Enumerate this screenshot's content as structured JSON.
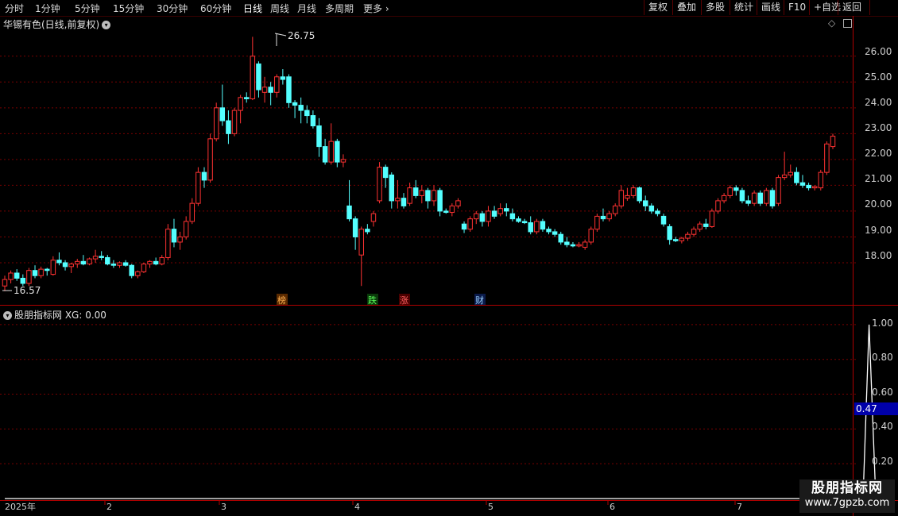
{
  "toolbar": {
    "tabs": [
      "分时",
      "1分钟",
      "5分钟",
      "15分钟",
      "30分钟",
      "60分钟",
      "日线",
      "周线",
      "月线",
      "多周期",
      "更多"
    ],
    "right_buttons": [
      "复权",
      "叠加",
      "多股",
      "统计",
      "画线",
      "F10",
      "+自选",
      "返回"
    ]
  },
  "main_panel": {
    "title": "华锡有色(日线,前复权)",
    "price_axis_labels": [
      "26.00",
      "25.00",
      "24.00",
      "23.00",
      "22.00",
      "21.00",
      "20.00",
      "19.00",
      "18.00"
    ],
    "high_label": "26.75",
    "low_label": "16.57",
    "event_markers": [
      "榜",
      "跌",
      "涨",
      "财"
    ]
  },
  "indicator_panel": {
    "title": "股朋指标网 XG: 0.00",
    "axis_labels": [
      "1.00",
      "0.80",
      "0.60",
      "0.40",
      "0.20"
    ],
    "current_value": "0.47"
  },
  "time_axis": {
    "labels": [
      "2025年",
      "2",
      "3",
      "4",
      "5",
      "6",
      "7"
    ]
  },
  "watermark": {
    "line1": "股朋指标网",
    "line2": "www.7gpzb.com"
  },
  "colors": {
    "up": "#ff3232",
    "down": "#54ffff",
    "grid": "#7a0000",
    "axis": "#b00000"
  },
  "chart_data": [
    {
      "type": "candlestick",
      "title": "华锡有色(日线,前复权)",
      "ylim": [
        16.4,
        27.1
      ],
      "annotations": {
        "high": 26.75,
        "low": 16.57
      },
      "candles": [
        [
          17.1,
          17.5,
          16.9,
          17.35
        ],
        [
          17.35,
          17.7,
          17.2,
          17.6
        ],
        [
          17.6,
          17.75,
          17.3,
          17.4
        ],
        [
          17.4,
          17.55,
          17.1,
          17.2
        ],
        [
          17.2,
          17.8,
          17.1,
          17.7
        ],
        [
          17.7,
          17.9,
          17.4,
          17.5
        ],
        [
          17.5,
          17.85,
          17.4,
          17.75
        ],
        [
          17.75,
          17.8,
          17.5,
          17.7
        ],
        [
          17.55,
          18.25,
          17.5,
          18.1
        ],
        [
          18.1,
          18.4,
          17.9,
          18.0
        ],
        [
          18.0,
          18.1,
          17.7,
          17.85
        ],
        [
          17.85,
          18.0,
          17.6,
          17.95
        ],
        [
          17.95,
          18.15,
          17.8,
          18.05
        ],
        [
          18.05,
          18.3,
          17.9,
          17.95
        ],
        [
          17.95,
          18.2,
          17.9,
          18.15
        ],
        [
          18.15,
          18.5,
          18.0,
          18.25
        ],
        [
          18.25,
          18.45,
          18.1,
          18.2
        ],
        [
          18.2,
          18.3,
          17.9,
          17.95
        ],
        [
          17.95,
          18.1,
          17.8,
          17.9
        ],
        [
          17.9,
          18.05,
          17.8,
          18.0
        ],
        [
          18.0,
          18.1,
          17.85,
          17.9
        ],
        [
          17.9,
          17.95,
          17.4,
          17.5
        ],
        [
          17.5,
          17.7,
          17.4,
          17.65
        ],
        [
          17.65,
          18.0,
          17.6,
          17.95
        ],
        [
          17.95,
          18.1,
          17.8,
          18.05
        ],
        [
          18.05,
          18.2,
          17.9,
          17.95
        ],
        [
          17.95,
          18.3,
          17.9,
          18.2
        ],
        [
          18.2,
          19.5,
          18.1,
          19.3
        ],
        [
          19.3,
          19.7,
          18.6,
          18.8
        ],
        [
          18.8,
          19.2,
          18.5,
          19.0
        ],
        [
          19.0,
          19.8,
          18.9,
          19.6
        ],
        [
          19.6,
          20.5,
          19.5,
          20.3
        ],
        [
          20.3,
          21.7,
          20.2,
          21.5
        ],
        [
          21.5,
          21.7,
          20.9,
          21.2
        ],
        [
          21.2,
          23.0,
          21.1,
          22.8
        ],
        [
          22.8,
          24.2,
          22.7,
          24.0
        ],
        [
          24.0,
          24.9,
          23.3,
          23.5
        ],
        [
          23.5,
          23.9,
          22.6,
          23.0
        ],
        [
          23.0,
          24.0,
          22.9,
          23.9
        ],
        [
          23.9,
          24.5,
          23.4,
          24.4
        ],
        [
          24.4,
          24.6,
          24.2,
          24.35
        ],
        [
          24.35,
          26.75,
          24.3,
          26.0
        ],
        [
          25.7,
          25.8,
          24.4,
          24.7
        ],
        [
          24.6,
          25.2,
          24.2,
          24.8
        ],
        [
          24.8,
          25.0,
          24.1,
          24.6
        ],
        [
          24.6,
          25.3,
          24.4,
          25.2
        ],
        [
          25.2,
          25.5,
          24.9,
          25.1
        ],
        [
          25.2,
          25.3,
          24.0,
          24.2
        ],
        [
          24.2,
          24.3,
          23.6,
          24.1
        ],
        [
          24.1,
          24.4,
          23.4,
          23.9
        ],
        [
          23.9,
          24.1,
          23.4,
          23.7
        ],
        [
          23.7,
          23.9,
          23.2,
          23.3
        ],
        [
          23.3,
          23.6,
          22.1,
          22.5
        ],
        [
          22.5,
          22.8,
          21.8,
          21.9
        ],
        [
          21.9,
          23.4,
          21.8,
          22.7
        ],
        [
          22.7,
          22.8,
          21.7,
          21.9
        ],
        [
          21.9,
          22.2,
          21.7,
          22.0
        ],
        [
          20.2,
          21.2,
          19.6,
          19.7
        ],
        [
          19.7,
          19.8,
          18.5,
          19.0
        ],
        [
          18.3,
          19.4,
          17.1,
          19.3
        ],
        [
          19.3,
          19.5,
          19.1,
          19.2
        ],
        [
          19.6,
          20.0,
          19.4,
          19.9
        ],
        [
          20.4,
          21.9,
          20.3,
          21.7
        ],
        [
          21.7,
          21.8,
          20.9,
          21.3
        ],
        [
          21.4,
          21.5,
          20.1,
          20.4
        ],
        [
          20.4,
          21.2,
          20.1,
          20.5
        ],
        [
          20.5,
          20.7,
          20.1,
          20.2
        ],
        [
          20.3,
          21.1,
          20.2,
          20.9
        ],
        [
          20.9,
          21.2,
          20.5,
          20.6
        ],
        [
          20.6,
          21.0,
          20.3,
          20.8
        ],
        [
          20.8,
          20.9,
          20.1,
          20.4
        ],
        [
          20.4,
          21.0,
          20.2,
          20.8
        ],
        [
          20.8,
          20.9,
          19.8,
          20.0
        ],
        [
          20.0,
          20.1,
          19.9,
          19.95
        ],
        [
          19.95,
          20.3,
          19.8,
          20.2
        ],
        [
          20.2,
          20.5,
          20.1,
          20.4
        ],
        [
          19.5,
          19.6,
          19.15,
          19.3
        ],
        [
          19.3,
          19.8,
          19.2,
          19.7
        ],
        [
          19.7,
          20.0,
          19.5,
          19.9
        ],
        [
          19.9,
          20.0,
          19.4,
          19.6
        ],
        [
          19.6,
          20.2,
          19.4,
          20.0
        ],
        [
          20.0,
          20.2,
          19.7,
          19.8
        ],
        [
          19.9,
          20.3,
          19.8,
          20.1
        ],
        [
          20.1,
          20.3,
          19.8,
          20.0
        ],
        [
          19.9,
          20.1,
          19.6,
          19.7
        ],
        [
          19.7,
          19.8,
          19.55,
          19.6
        ],
        [
          19.6,
          19.7,
          19.5,
          19.55
        ],
        [
          19.55,
          19.8,
          19.1,
          19.2
        ],
        [
          19.2,
          19.7,
          19.1,
          19.6
        ],
        [
          19.6,
          19.7,
          19.2,
          19.3
        ],
        [
          19.3,
          19.4,
          19.1,
          19.2
        ],
        [
          19.2,
          19.3,
          19.0,
          19.1
        ],
        [
          19.1,
          19.2,
          18.7,
          18.8
        ],
        [
          18.8,
          19.0,
          18.6,
          18.7
        ],
        [
          18.7,
          18.8,
          18.6,
          18.65
        ],
        [
          18.65,
          18.8,
          18.6,
          18.7
        ],
        [
          18.6,
          18.9,
          18.5,
          18.8
        ],
        [
          18.8,
          19.4,
          18.7,
          19.3
        ],
        [
          19.3,
          19.9,
          19.2,
          19.8
        ],
        [
          19.8,
          20.1,
          19.6,
          19.7
        ],
        [
          19.7,
          20.0,
          19.6,
          19.9
        ],
        [
          19.9,
          20.3,
          19.8,
          20.2
        ],
        [
          20.2,
          21.0,
          20.1,
          20.8
        ],
        [
          20.5,
          20.9,
          20.4,
          20.6
        ],
        [
          20.6,
          21.0,
          20.5,
          20.9
        ],
        [
          20.9,
          20.95,
          20.3,
          20.4
        ],
        [
          20.4,
          20.6,
          20.0,
          20.2
        ],
        [
          20.2,
          20.3,
          19.9,
          20.0
        ],
        [
          20.0,
          20.1,
          19.8,
          19.9
        ],
        [
          19.8,
          19.9,
          19.4,
          19.5
        ],
        [
          19.4,
          19.5,
          18.7,
          18.9
        ],
        [
          18.9,
          19.0,
          18.8,
          18.85
        ],
        [
          18.85,
          19.0,
          18.75,
          18.95
        ],
        [
          18.95,
          19.2,
          18.85,
          19.1
        ],
        [
          19.1,
          19.4,
          19.0,
          19.3
        ],
        [
          19.3,
          19.6,
          19.2,
          19.5
        ],
        [
          19.5,
          19.7,
          19.3,
          19.4
        ],
        [
          19.4,
          20.1,
          19.35,
          20.0
        ],
        [
          20.0,
          20.5,
          19.9,
          20.4
        ],
        [
          20.4,
          20.7,
          20.3,
          20.6
        ],
        [
          20.6,
          21.0,
          20.5,
          20.9
        ],
        [
          20.9,
          21.0,
          20.6,
          20.8
        ],
        [
          20.8,
          20.9,
          20.3,
          20.4
        ],
        [
          20.4,
          20.6,
          20.2,
          20.3
        ],
        [
          20.3,
          20.8,
          20.2,
          20.7
        ],
        [
          20.7,
          20.8,
          20.2,
          20.3
        ],
        [
          20.3,
          20.9,
          20.2,
          20.8
        ],
        [
          20.8,
          20.9,
          20.1,
          20.2
        ],
        [
          20.3,
          21.4,
          20.2,
          21.3
        ],
        [
          21.3,
          22.3,
          21.2,
          21.4
        ],
        [
          21.4,
          21.8,
          21.3,
          21.5
        ],
        [
          21.5,
          21.7,
          21.0,
          21.1
        ],
        [
          21.1,
          21.4,
          20.9,
          21.0
        ],
        [
          21.0,
          21.1,
          20.8,
          20.9
        ],
        [
          20.9,
          21.0,
          20.8,
          20.95
        ],
        [
          20.9,
          21.6,
          20.8,
          21.5
        ],
        [
          21.5,
          22.7,
          21.4,
          22.6
        ],
        [
          22.5,
          23.0,
          22.4,
          22.9
        ]
      ]
    },
    {
      "type": "line",
      "title": "股朋指标网 XG: 0.00",
      "ylim": [
        0,
        1.1
      ],
      "series": [
        {
          "values": [
            0,
            0,
            0,
            0,
            0,
            0,
            0,
            0,
            0,
            0,
            0,
            0,
            0,
            0,
            0,
            0,
            0,
            0,
            0,
            0,
            0,
            0,
            0,
            0,
            0,
            0,
            0,
            0,
            0,
            0,
            0,
            0,
            0,
            0,
            0,
            0,
            0,
            0,
            0,
            0,
            0,
            0,
            0,
            0,
            0,
            0,
            0,
            0,
            0,
            0,
            0,
            0,
            0,
            0,
            0,
            0,
            0,
            0,
            0,
            0,
            0,
            0,
            0,
            0,
            0,
            0,
            0,
            0,
            0,
            0,
            0,
            0,
            0,
            0,
            0,
            0,
            0,
            0,
            0,
            0,
            0,
            0,
            0,
            0,
            0,
            0,
            0,
            0,
            0,
            0,
            0,
            0,
            0,
            0,
            0,
            0,
            0,
            0,
            0,
            0,
            0,
            0,
            0,
            0,
            0,
            0,
            0,
            0,
            0,
            0,
            0,
            0,
            0,
            0,
            0,
            0,
            0,
            0,
            0,
            0,
            0,
            0,
            0,
            0,
            0,
            0,
            0,
            0,
            0,
            0,
            0,
            0,
            0,
            0,
            0,
            0,
            0,
            0,
            0,
            0,
            0,
            0,
            0,
            1,
            0.1,
            0
          ]
        }
      ]
    }
  ]
}
